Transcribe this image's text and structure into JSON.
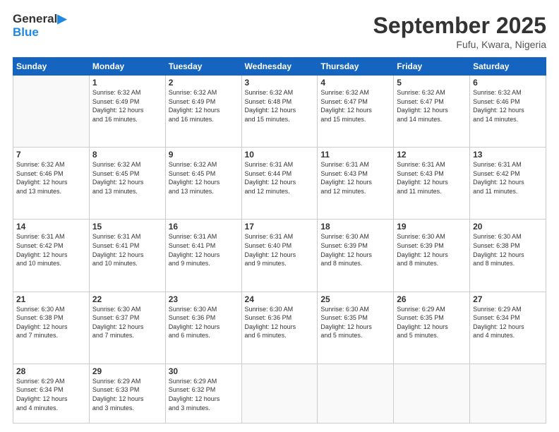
{
  "logo": {
    "general": "General",
    "blue": "Blue"
  },
  "header": {
    "month": "September 2025",
    "location": "Fufu, Kwara, Nigeria"
  },
  "days": [
    "Sunday",
    "Monday",
    "Tuesday",
    "Wednesday",
    "Thursday",
    "Friday",
    "Saturday"
  ],
  "weeks": [
    [
      {
        "num": "",
        "info": ""
      },
      {
        "num": "1",
        "info": "Sunrise: 6:32 AM\nSunset: 6:49 PM\nDaylight: 12 hours\nand 16 minutes."
      },
      {
        "num": "2",
        "info": "Sunrise: 6:32 AM\nSunset: 6:49 PM\nDaylight: 12 hours\nand 16 minutes."
      },
      {
        "num": "3",
        "info": "Sunrise: 6:32 AM\nSunset: 6:48 PM\nDaylight: 12 hours\nand 15 minutes."
      },
      {
        "num": "4",
        "info": "Sunrise: 6:32 AM\nSunset: 6:47 PM\nDaylight: 12 hours\nand 15 minutes."
      },
      {
        "num": "5",
        "info": "Sunrise: 6:32 AM\nSunset: 6:47 PM\nDaylight: 12 hours\nand 14 minutes."
      },
      {
        "num": "6",
        "info": "Sunrise: 6:32 AM\nSunset: 6:46 PM\nDaylight: 12 hours\nand 14 minutes."
      }
    ],
    [
      {
        "num": "7",
        "info": "Sunrise: 6:32 AM\nSunset: 6:46 PM\nDaylight: 12 hours\nand 13 minutes."
      },
      {
        "num": "8",
        "info": "Sunrise: 6:32 AM\nSunset: 6:45 PM\nDaylight: 12 hours\nand 13 minutes."
      },
      {
        "num": "9",
        "info": "Sunrise: 6:32 AM\nSunset: 6:45 PM\nDaylight: 12 hours\nand 13 minutes."
      },
      {
        "num": "10",
        "info": "Sunrise: 6:31 AM\nSunset: 6:44 PM\nDaylight: 12 hours\nand 12 minutes."
      },
      {
        "num": "11",
        "info": "Sunrise: 6:31 AM\nSunset: 6:43 PM\nDaylight: 12 hours\nand 12 minutes."
      },
      {
        "num": "12",
        "info": "Sunrise: 6:31 AM\nSunset: 6:43 PM\nDaylight: 12 hours\nand 11 minutes."
      },
      {
        "num": "13",
        "info": "Sunrise: 6:31 AM\nSunset: 6:42 PM\nDaylight: 12 hours\nand 11 minutes."
      }
    ],
    [
      {
        "num": "14",
        "info": "Sunrise: 6:31 AM\nSunset: 6:42 PM\nDaylight: 12 hours\nand 10 minutes."
      },
      {
        "num": "15",
        "info": "Sunrise: 6:31 AM\nSunset: 6:41 PM\nDaylight: 12 hours\nand 10 minutes."
      },
      {
        "num": "16",
        "info": "Sunrise: 6:31 AM\nSunset: 6:41 PM\nDaylight: 12 hours\nand 9 minutes."
      },
      {
        "num": "17",
        "info": "Sunrise: 6:31 AM\nSunset: 6:40 PM\nDaylight: 12 hours\nand 9 minutes."
      },
      {
        "num": "18",
        "info": "Sunrise: 6:30 AM\nSunset: 6:39 PM\nDaylight: 12 hours\nand 8 minutes."
      },
      {
        "num": "19",
        "info": "Sunrise: 6:30 AM\nSunset: 6:39 PM\nDaylight: 12 hours\nand 8 minutes."
      },
      {
        "num": "20",
        "info": "Sunrise: 6:30 AM\nSunset: 6:38 PM\nDaylight: 12 hours\nand 8 minutes."
      }
    ],
    [
      {
        "num": "21",
        "info": "Sunrise: 6:30 AM\nSunset: 6:38 PM\nDaylight: 12 hours\nand 7 minutes."
      },
      {
        "num": "22",
        "info": "Sunrise: 6:30 AM\nSunset: 6:37 PM\nDaylight: 12 hours\nand 7 minutes."
      },
      {
        "num": "23",
        "info": "Sunrise: 6:30 AM\nSunset: 6:36 PM\nDaylight: 12 hours\nand 6 minutes."
      },
      {
        "num": "24",
        "info": "Sunrise: 6:30 AM\nSunset: 6:36 PM\nDaylight: 12 hours\nand 6 minutes."
      },
      {
        "num": "25",
        "info": "Sunrise: 6:30 AM\nSunset: 6:35 PM\nDaylight: 12 hours\nand 5 minutes."
      },
      {
        "num": "26",
        "info": "Sunrise: 6:29 AM\nSunset: 6:35 PM\nDaylight: 12 hours\nand 5 minutes."
      },
      {
        "num": "27",
        "info": "Sunrise: 6:29 AM\nSunset: 6:34 PM\nDaylight: 12 hours\nand 4 minutes."
      }
    ],
    [
      {
        "num": "28",
        "info": "Sunrise: 6:29 AM\nSunset: 6:34 PM\nDaylight: 12 hours\nand 4 minutes."
      },
      {
        "num": "29",
        "info": "Sunrise: 6:29 AM\nSunset: 6:33 PM\nDaylight: 12 hours\nand 3 minutes."
      },
      {
        "num": "30",
        "info": "Sunrise: 6:29 AM\nSunset: 6:32 PM\nDaylight: 12 hours\nand 3 minutes."
      },
      {
        "num": "",
        "info": ""
      },
      {
        "num": "",
        "info": ""
      },
      {
        "num": "",
        "info": ""
      },
      {
        "num": "",
        "info": ""
      }
    ]
  ]
}
